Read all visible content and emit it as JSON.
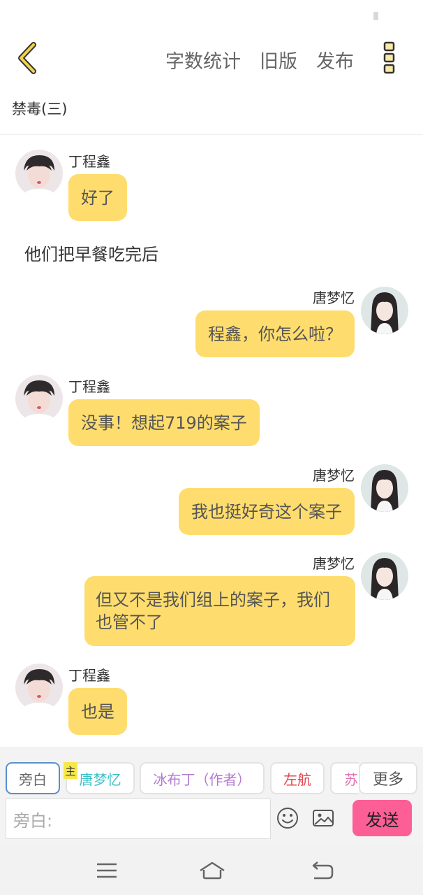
{
  "header": {
    "actions": [
      "字数统计",
      "旧版",
      "发布"
    ],
    "back_icon": "chevron-left-icon",
    "more_icon": "vertical-dots-icon",
    "accent_color": "#f2c94c"
  },
  "chapter": {
    "title": "禁毒(三)"
  },
  "messages": [
    {
      "sender": "丁程鑫",
      "side": "left",
      "text": "好了"
    },
    {
      "narration": "他们把早餐吃完后"
    },
    {
      "sender": "唐梦忆",
      "side": "right",
      "text": "程鑫，你怎么啦？"
    },
    {
      "sender": "丁程鑫",
      "side": "left",
      "text": "没事！想起719的案子"
    },
    {
      "sender": "唐梦忆",
      "side": "right",
      "text": "我也挺好奇这个案子"
    },
    {
      "sender": "唐梦忆",
      "side": "right",
      "text": "但又不是我们组上的案子，我们也管不了"
    },
    {
      "sender": "丁程鑫",
      "side": "left",
      "text": "也是"
    }
  ],
  "composer": {
    "tabs": [
      {
        "label": "旁白",
        "color": "#666666",
        "active": true
      },
      {
        "label": "唐梦忆",
        "color": "#3cc0c6"
      },
      {
        "label": "冰布丁（作者）",
        "color": "#b57ad0"
      },
      {
        "label": "左航",
        "color": "#e0454f"
      },
      {
        "label": "苏",
        "color": "#e36fb0"
      }
    ],
    "host_badge": "主",
    "more_label": "更多",
    "input_placeholder": "旁白:",
    "send_label": "发送",
    "send_color": "#fc5e96",
    "emoji_icon": "smiley-icon",
    "image_icon": "image-icon"
  },
  "nav": {
    "icons": [
      "menu-icon",
      "home-icon",
      "back-icon"
    ]
  }
}
